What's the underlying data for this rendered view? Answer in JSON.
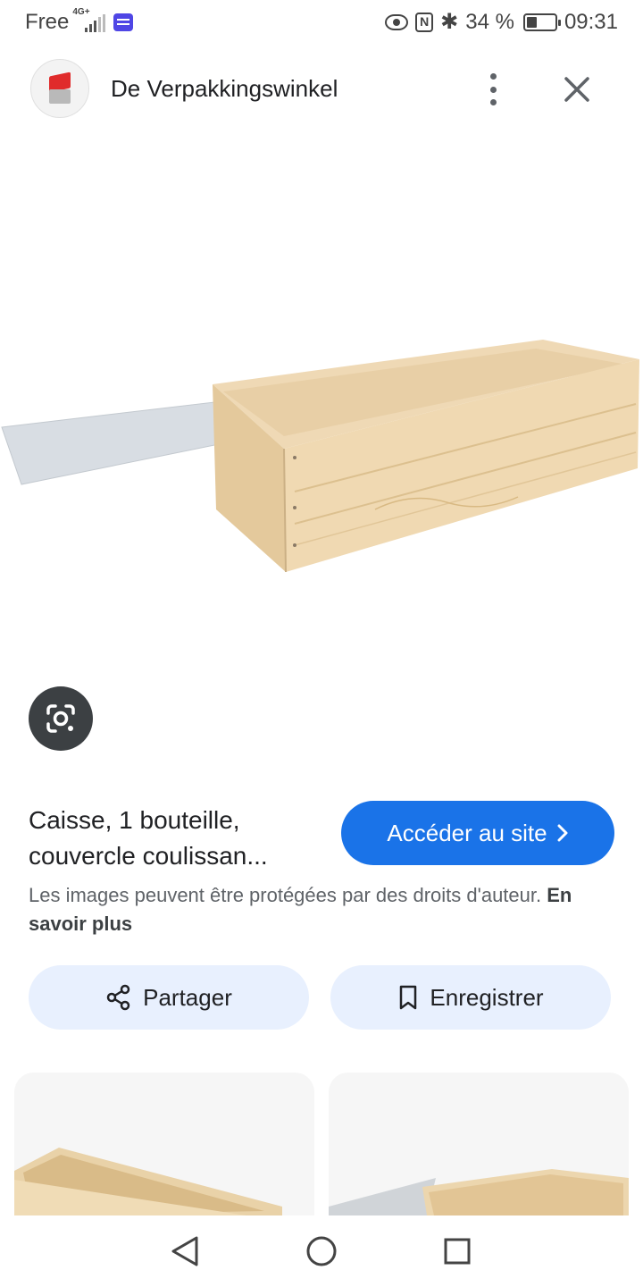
{
  "status_bar": {
    "carrier": "Free",
    "network": "4G+",
    "battery": "34 %",
    "time": "09:31",
    "icons": [
      "signal-icon",
      "app-notification-icon",
      "eye-icon",
      "nfc-icon",
      "bluetooth-icon",
      "battery-icon"
    ]
  },
  "header": {
    "site_name": "De Verpakkingswinkel",
    "icons": [
      "site-logo",
      "more-options-icon",
      "close-icon"
    ]
  },
  "product": {
    "title": "Caisse, 1 bouteille, couvercle coulissan...",
    "visit_label": "Accéder au site",
    "disclaimer": "Les images peuvent être protégées par des droits d'auteur.",
    "learn_more": "En savoir plus"
  },
  "actions": {
    "share_label": "Partager",
    "save_label": "Enregistrer"
  },
  "colors": {
    "accent": "#1a73e8",
    "pill_bg": "#e8f0fe",
    "lens_bg": "#3c4043"
  }
}
